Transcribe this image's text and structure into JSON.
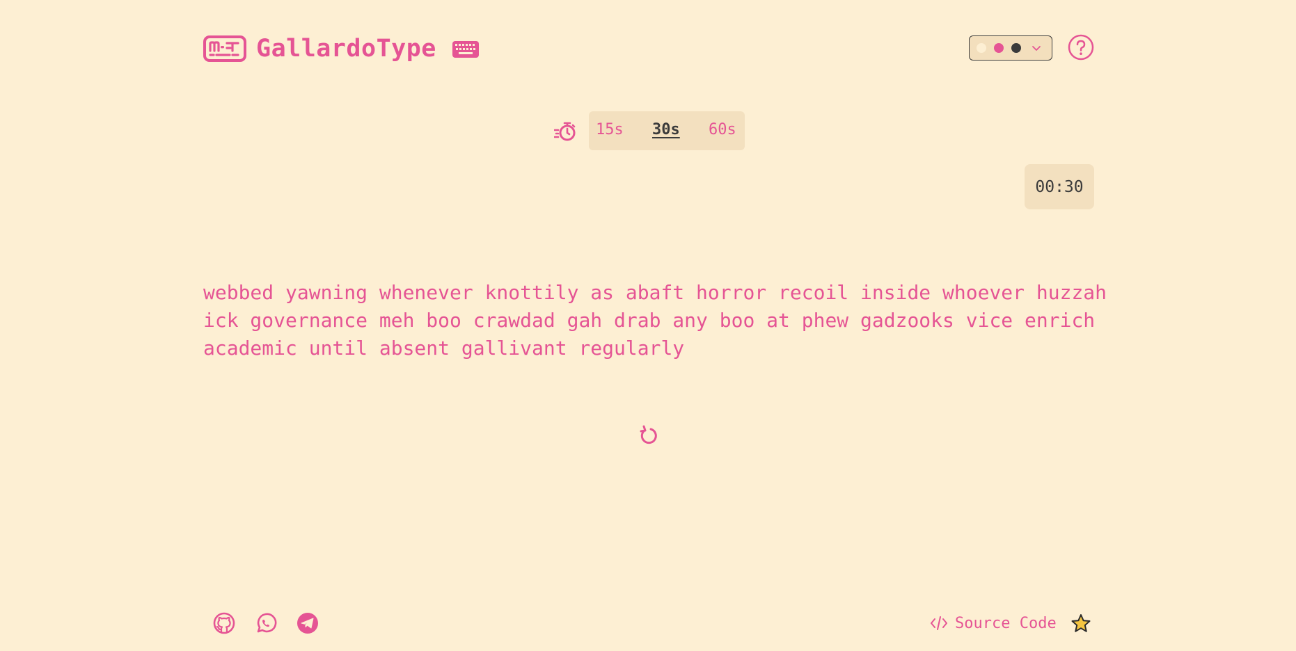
{
  "app": {
    "name": "GallardoType",
    "logo_icon": "mt-logo-icon",
    "keyboard_icon": "keyboard-icon"
  },
  "theme": {
    "swatches": [
      "#fdefd3",
      "#e55494",
      "#3b3b3b"
    ],
    "dropdown_icon": "chevron-down-icon"
  },
  "help": {
    "icon": "question-icon"
  },
  "time_selector": {
    "icon": "stopwatch-icon",
    "options": [
      "15s",
      "30s",
      "60s"
    ],
    "selected": "30s"
  },
  "timer": {
    "value": "00:30"
  },
  "words": {
    "lines": [
      "webbed yawning whenever knottily as abaft horror recoil inside whoever huzzah",
      "ick governance meh boo crawdad gah drab any boo at phew gadzooks vice enrich",
      "academic until absent gallivant regularly"
    ]
  },
  "restart": {
    "icon": "restart-icon"
  },
  "footer": {
    "social": [
      "github-icon",
      "whatsapp-icon",
      "telegram-icon"
    ],
    "source_label": "Source Code",
    "source_icon": "code-icon",
    "star_icon": "star-icon"
  },
  "colors": {
    "background": "#fdefd3",
    "accent": "#e55494",
    "text_dark": "#3b3b3b",
    "panel": "#f3e0bf",
    "star": "#f5c542"
  }
}
